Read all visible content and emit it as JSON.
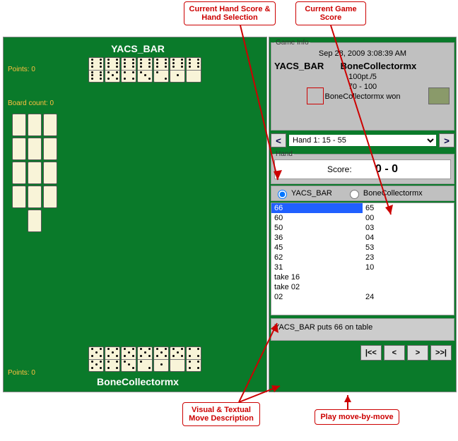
{
  "callouts": {
    "hand_score": "Current Hand Score & Hand Selection",
    "game_score": "Current Game Score",
    "move_desc": "Visual & Textual Move Description",
    "playback": "Play move-by-move"
  },
  "board": {
    "top_player": "YACS_BAR",
    "bottom_player": "BoneCollectormx",
    "points_top": "Points: 0",
    "points_bottom": "Points: 0",
    "board_count": "Board count: 0"
  },
  "top_hand": [
    [
      6,
      6
    ],
    [
      6,
      5
    ],
    [
      6,
      4
    ],
    [
      6,
      3
    ],
    [
      6,
      2
    ],
    [
      6,
      1
    ],
    [
      6,
      0
    ]
  ],
  "bottom_hand": [
    [
      5,
      5
    ],
    [
      5,
      4
    ],
    [
      5,
      3
    ],
    [
      5,
      2
    ],
    [
      5,
      1
    ],
    [
      5,
      0
    ],
    [
      4,
      4
    ]
  ],
  "game_info": {
    "legend": "Game Info",
    "date": "Sep 28, 2009 3:08:39 AM",
    "p1": "YACS_BAR",
    "p2": "BoneCollectormx",
    "stakes": "100pt./5",
    "score": "70 - 100",
    "result": "BoneCollectormx won"
  },
  "hand_selector": {
    "prev": "<",
    "next": ">",
    "selected": "Hand 1: 15 - 55"
  },
  "hand": {
    "legend": "Hand",
    "score_label": "Score:",
    "score_value": "0 - 0"
  },
  "players_radio": {
    "p1": "YACS_BAR",
    "p2": "BoneCollectormx"
  },
  "moves": {
    "left": [
      "66",
      "60",
      "50",
      "36",
      "45",
      "62",
      "31",
      "take 16",
      "take 02",
      "02"
    ],
    "right": [
      "65",
      "00",
      "03",
      "04",
      "53",
      "23",
      "10",
      "",
      "",
      "24"
    ]
  },
  "move_description": "YACS_BAR puts 66 on table",
  "playback": {
    "first": "|<<",
    "prev": "<",
    "next": ">",
    "last": ">>|"
  }
}
